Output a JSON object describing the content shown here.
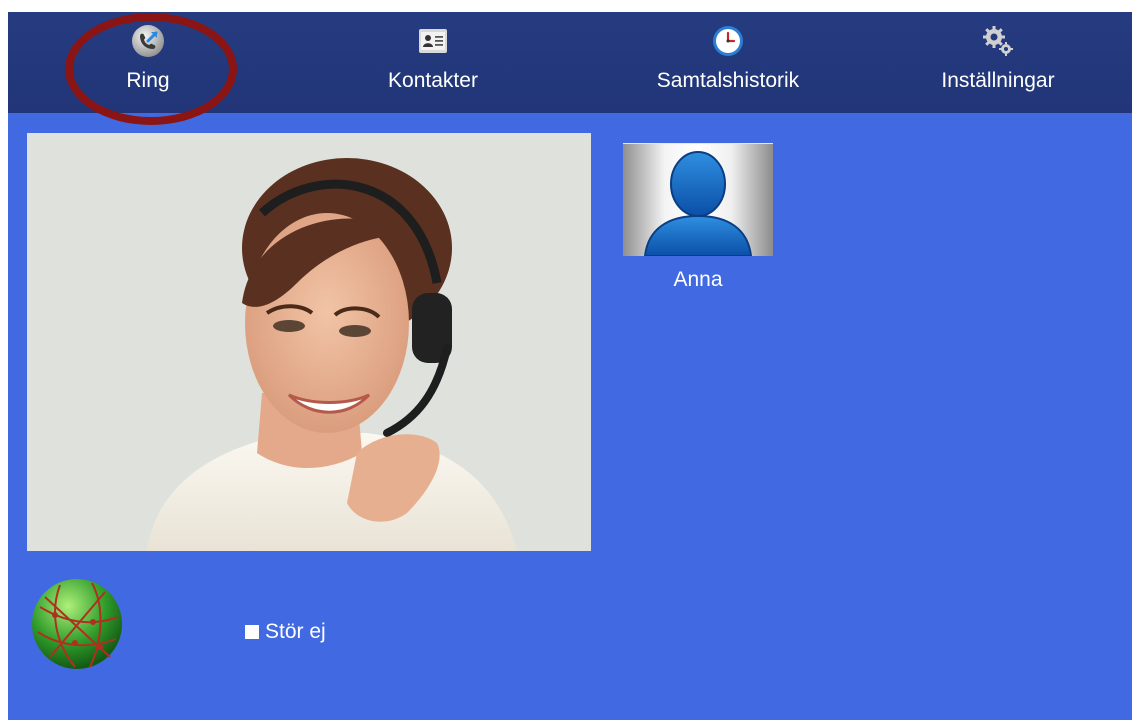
{
  "nav": {
    "items": [
      {
        "label": "Ring",
        "icon": "phone-call-icon"
      },
      {
        "label": "Kontakter",
        "icon": "address-card-icon"
      },
      {
        "label": "Samtalshistorik",
        "icon": "clock-icon"
      },
      {
        "label": "Inställningar",
        "icon": "gears-icon"
      }
    ],
    "highlighted": "Ring"
  },
  "video": {
    "icon": "video-feed-woman-headset"
  },
  "contact": {
    "name": "Anna",
    "icon": "person-silhouette-icon"
  },
  "status": {
    "icon": "globe-icon"
  },
  "dnd": {
    "label": "Stör ej",
    "checked": false
  },
  "colors": {
    "background": "#4169e1",
    "topbar": "#233a7d",
    "highlight": "#8b1414",
    "text": "#ffffff"
  }
}
